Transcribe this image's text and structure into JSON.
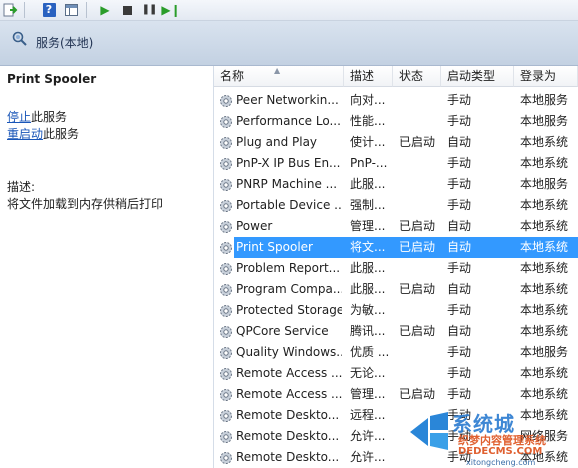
{
  "toolbar": {
    "buttons": [
      {
        "name": "export-list-icon"
      },
      {
        "name": "help-icon",
        "glyph": "?"
      },
      {
        "name": "show-hide-pane-icon"
      },
      {
        "name": "start-service-icon"
      },
      {
        "name": "stop-service-icon"
      },
      {
        "name": "pause-service-icon"
      },
      {
        "name": "restart-service-icon"
      }
    ]
  },
  "header": {
    "title": "服务(本地)"
  },
  "left_pane": {
    "service_name": "Print Spooler",
    "actions": [
      {
        "link": "停止",
        "suffix": "此服务"
      },
      {
        "link": "重启动",
        "suffix": "此服务"
      }
    ],
    "description_label": "描述:",
    "description_text": "将文件加载到内存供稍后打印"
  },
  "table": {
    "columns": [
      "名称",
      "描述",
      "状态",
      "启动类型",
      "登录为"
    ],
    "selected_index": 7,
    "rows": [
      {
        "name": "Peer Networkin...",
        "desc": "向对...",
        "status": "",
        "startup": "手动",
        "logon": "本地服务"
      },
      {
        "name": "Performance Lo...",
        "desc": "性能...",
        "status": "",
        "startup": "手动",
        "logon": "本地服务"
      },
      {
        "name": "Plug and Play",
        "desc": "使计...",
        "status": "已启动",
        "startup": "自动",
        "logon": "本地系统"
      },
      {
        "name": "PnP-X IP Bus En...",
        "desc": "PnP-...",
        "status": "",
        "startup": "手动",
        "logon": "本地系统"
      },
      {
        "name": "PNRP Machine ...",
        "desc": "此服...",
        "status": "",
        "startup": "手动",
        "logon": "本地服务"
      },
      {
        "name": "Portable Device ...",
        "desc": "强制...",
        "status": "",
        "startup": "手动",
        "logon": "本地系统"
      },
      {
        "name": "Power",
        "desc": "管理...",
        "status": "已启动",
        "startup": "自动",
        "logon": "本地系统"
      },
      {
        "name": "Print Spooler",
        "desc": "将文...",
        "status": "已启动",
        "startup": "自动",
        "logon": "本地系统"
      },
      {
        "name": "Problem Report...",
        "desc": "此服...",
        "status": "",
        "startup": "手动",
        "logon": "本地系统"
      },
      {
        "name": "Program Compa...",
        "desc": "此服...",
        "status": "已启动",
        "startup": "自动",
        "logon": "本地系统"
      },
      {
        "name": "Protected Storage",
        "desc": "为敏...",
        "status": "",
        "startup": "手动",
        "logon": "本地系统"
      },
      {
        "name": "QPCore Service",
        "desc": "腾讯...",
        "status": "已启动",
        "startup": "自动",
        "logon": "本地系统"
      },
      {
        "name": "Quality Windows...",
        "desc": "优质 ...",
        "status": "",
        "startup": "手动",
        "logon": "本地服务"
      },
      {
        "name": "Remote Access ...",
        "desc": "无论...",
        "status": "",
        "startup": "手动",
        "logon": "本地系统"
      },
      {
        "name": "Remote Access ...",
        "desc": "管理...",
        "status": "已启动",
        "startup": "手动",
        "logon": "本地系统"
      },
      {
        "name": "Remote Deskto...",
        "desc": "远程...",
        "status": "",
        "startup": "手动",
        "logon": "本地系统"
      },
      {
        "name": "Remote Deskto...",
        "desc": "允许...",
        "status": "",
        "startup": "手动",
        "logon": "网络服务"
      },
      {
        "name": "Remote Deskto...",
        "desc": "允许...",
        "status": "",
        "startup": "手动",
        "logon": "本地系统"
      }
    ]
  },
  "watermark": {
    "line1": "系统城",
    "line2": "织梦内容管理系统",
    "line3": "DEDECMS.COM",
    "url": "xitongcheng.com"
  }
}
